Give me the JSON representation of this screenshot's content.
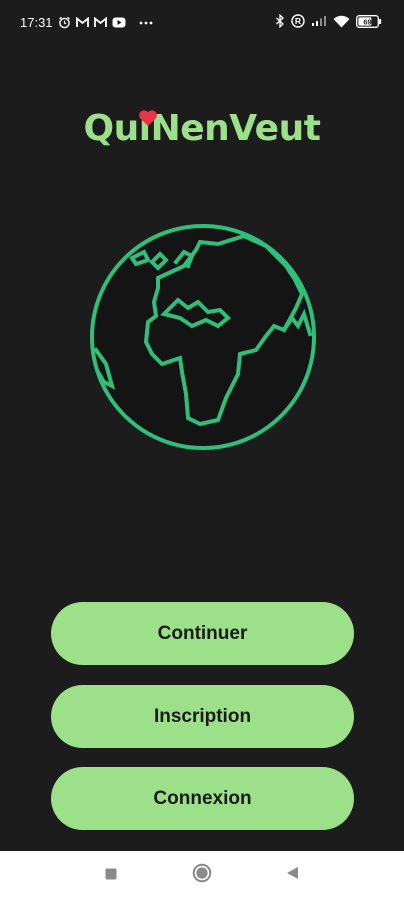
{
  "status_bar": {
    "time": "17:31",
    "left_icons": [
      "alarm-icon",
      "gmail-icon",
      "gmail-icon",
      "youtube-icon",
      "more-dots-icon"
    ],
    "right_icons": [
      "bluetooth-icon",
      "registered-icon",
      "signal-icon",
      "wifi-icon",
      "battery-icon"
    ],
    "battery": "69"
  },
  "app": {
    "title": "QuiNenVeut",
    "brand_color": "#9ce089",
    "heart_color": "#e8344a",
    "globe_color": "#2fbf7a",
    "background": "#1c1c1c"
  },
  "buttons": {
    "continue_label": "Continuer",
    "signup_label": "Inscription",
    "login_label": "Connexion"
  },
  "nav_bar": {
    "items": [
      "recents-square-icon",
      "home-circle-icon",
      "back-triangle-icon"
    ]
  }
}
